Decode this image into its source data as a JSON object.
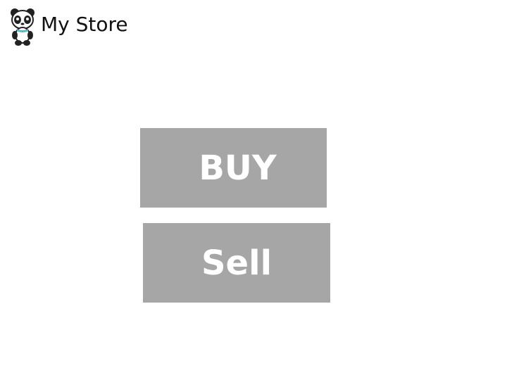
{
  "header": {
    "title": "My Store",
    "logo_icon": "panda-icon"
  },
  "actions": {
    "buy_label": "BUY",
    "sell_label": "Sell"
  },
  "colors": {
    "button_background": "#a6a6a6",
    "button_text": "#ffffff",
    "page_background": "#ffffff",
    "title_text": "#111111"
  }
}
